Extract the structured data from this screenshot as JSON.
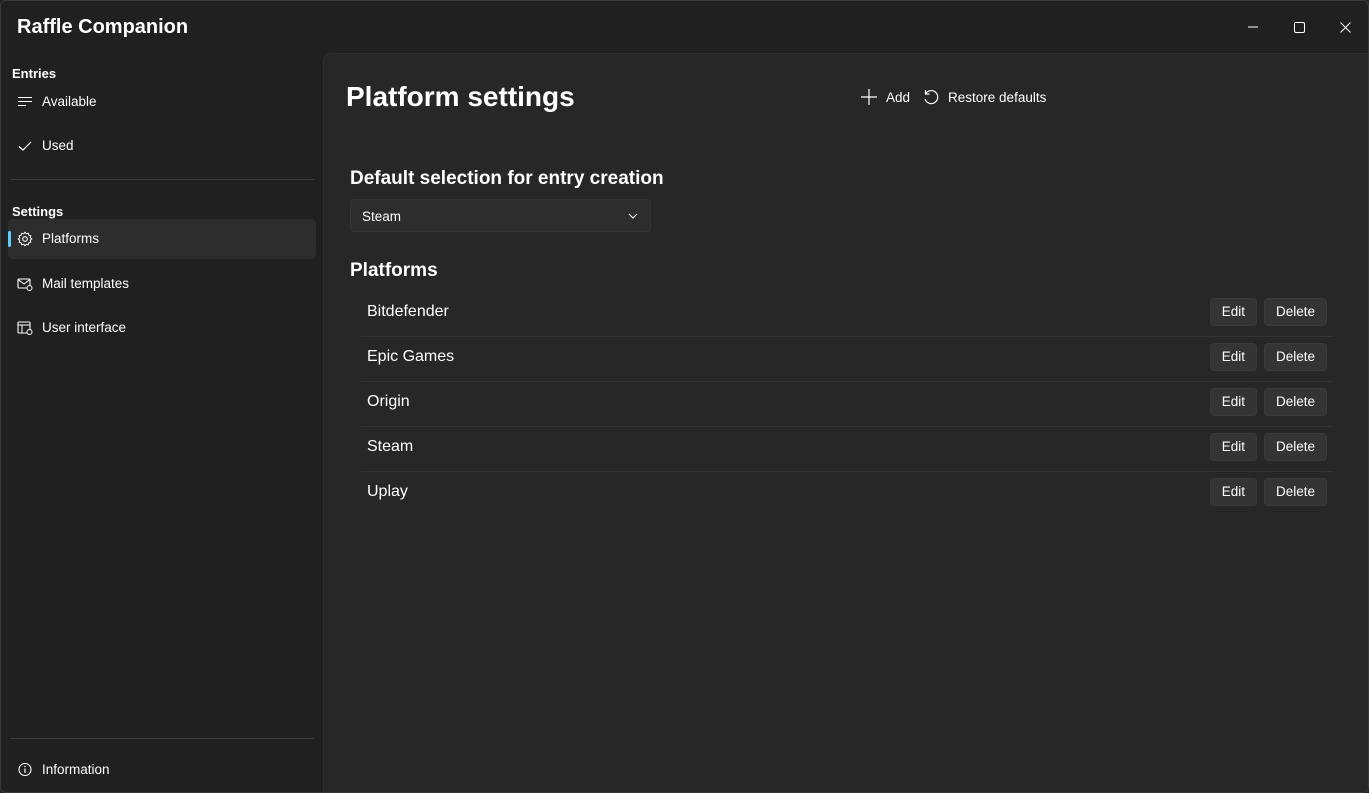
{
  "window": {
    "title": "Raffle Companion",
    "controls": {
      "minimize": "minimize-icon",
      "maximize": "maximize-icon",
      "close": "close-icon"
    }
  },
  "sidebar": {
    "entries_header": "Entries",
    "entries": [
      {
        "label": "Available",
        "icon": "list-icon"
      },
      {
        "label": "Used",
        "icon": "checkmark-icon"
      }
    ],
    "settings_header": "Settings",
    "settings": [
      {
        "label": "Platforms",
        "icon": "gear-icon",
        "selected": true
      },
      {
        "label": "Mail templates",
        "icon": "mail-settings-icon"
      },
      {
        "label": "User interface",
        "icon": "window-settings-icon"
      }
    ],
    "footer": {
      "label": "Information",
      "icon": "info-icon"
    }
  },
  "main": {
    "title": "Platform settings",
    "commands": {
      "add": "Add",
      "restore": "Restore defaults"
    },
    "default_selection_header": "Default selection for entry creation",
    "default_selection_value": "Steam",
    "platforms_header": "Platforms",
    "platforms": [
      "Bitdefender",
      "Epic Games",
      "Origin",
      "Steam",
      "Uplay"
    ],
    "edit_label": "Edit",
    "delete_label": "Delete"
  },
  "colors": {
    "accent": "#60cdff",
    "background": "#202020",
    "content": "#272727"
  }
}
